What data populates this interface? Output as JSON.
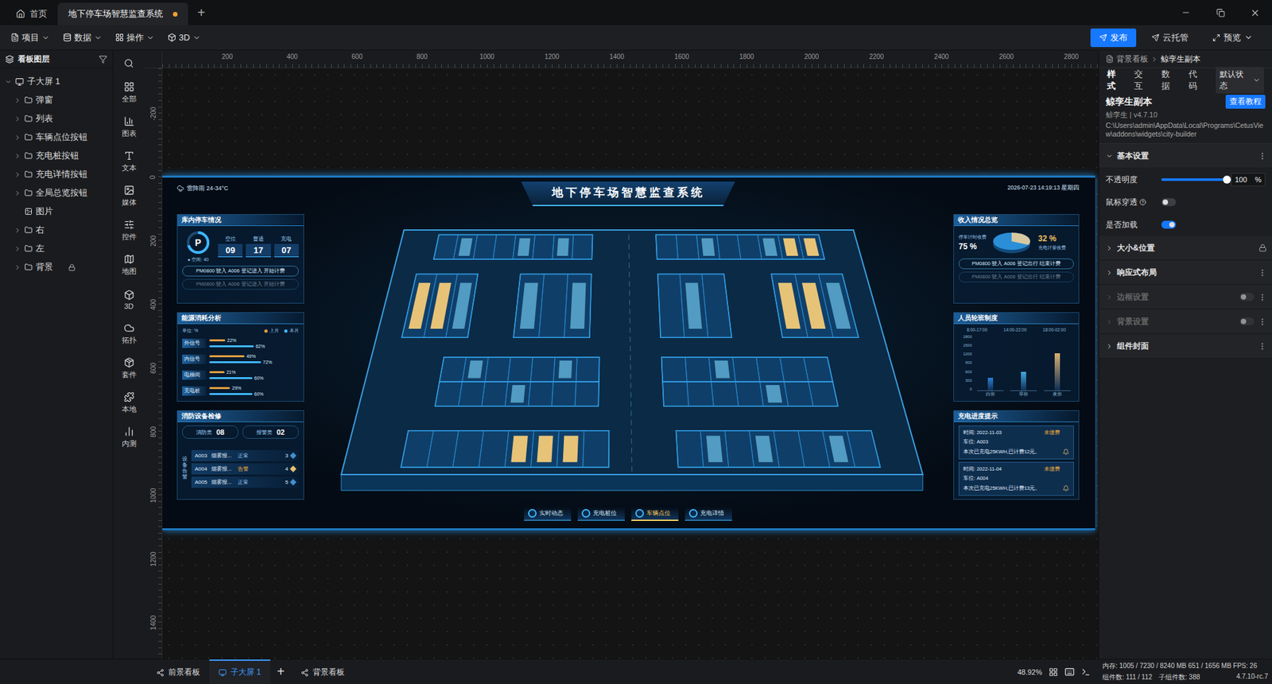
{
  "tabs": [
    {
      "label": "首页",
      "selected": false,
      "modified": false,
      "kind": "home"
    },
    {
      "label": "地下停车场智慧监查系统",
      "selected": true,
      "modified": true,
      "kind": "doc"
    }
  ],
  "new_tab": "+",
  "menus": [
    {
      "label": "项目",
      "kind": "project"
    },
    {
      "label": "数据",
      "kind": "data"
    },
    {
      "label": "操作",
      "kind": "ops"
    },
    {
      "label": "3D",
      "kind": "3d"
    }
  ],
  "actions": [
    {
      "label": "发布",
      "primary": true,
      "kind": "publish"
    },
    {
      "label": "云托管",
      "primary": false,
      "kind": "cloud"
    },
    {
      "label": "预览",
      "primary": false,
      "kind": "preview"
    }
  ],
  "layers": {
    "title": "看板图层",
    "root": {
      "label": "子大屏 1",
      "expanded": true
    },
    "items": [
      {
        "label": "弹窗",
        "expandable": true,
        "locked": false,
        "kind": "group"
      },
      {
        "label": "列表",
        "expandable": true,
        "locked": false,
        "kind": "group"
      },
      {
        "label": "车辆点位按钮",
        "expandable": true,
        "locked": false,
        "kind": "group"
      },
      {
        "label": "充电桩按钮",
        "expandable": true,
        "locked": false,
        "kind": "group"
      },
      {
        "label": "充电详情按钮",
        "expandable": true,
        "locked": false,
        "kind": "group"
      },
      {
        "label": "全局总览按钮",
        "expandable": true,
        "locked": false,
        "kind": "group"
      },
      {
        "label": "图片",
        "expandable": false,
        "locked": false,
        "kind": "image"
      },
      {
        "label": "右",
        "expandable": true,
        "locked": false,
        "kind": "group"
      },
      {
        "label": "左",
        "expandable": true,
        "locked": false,
        "kind": "group"
      },
      {
        "label": "背景",
        "expandable": true,
        "locked": true,
        "kind": "group"
      }
    ]
  },
  "widgets": [
    {
      "label": "全部",
      "kind": "all"
    },
    {
      "label": "图表",
      "kind": "chart"
    },
    {
      "label": "文本",
      "kind": "text"
    },
    {
      "label": "媒体",
      "kind": "media"
    },
    {
      "label": "控件",
      "kind": "control"
    },
    {
      "label": "地图",
      "kind": "map"
    },
    {
      "label": "3D",
      "kind": "3d"
    },
    {
      "label": "拓扑",
      "kind": "topo"
    },
    {
      "label": "套件",
      "kind": "kit"
    },
    {
      "label": "本地",
      "kind": "local"
    },
    {
      "label": "内测",
      "kind": "beta"
    }
  ],
  "rulers": {
    "top": [
      "200",
      "400",
      "600",
      "800",
      "1000",
      "1200",
      "1400",
      "1600",
      "1800",
      "2000",
      "2200",
      "2400",
      "2600",
      "2800"
    ],
    "left": [
      "-200",
      "0",
      "200",
      "400",
      "600",
      "800",
      "1000",
      "1200",
      "1400"
    ]
  },
  "dashboard": {
    "weather": "雷阵雨 24-34°C",
    "title": "地下停车场智慧监查系统",
    "datetime": "2026-07-23 14:19:13 星期四",
    "parking": {
      "title": "库内停车情况",
      "gauge_label": "P",
      "gauge_level": 0.7,
      "free": "● 空闲: 40",
      "stats": [
        {
          "label": "空位",
          "value": "09"
        },
        {
          "label": "普通",
          "value": "17"
        },
        {
          "label": "充电",
          "value": "07"
        }
      ],
      "logs": [
        {
          "text": "PM0800 驶入 A006 登记进入 开始计费",
          "faded": false
        },
        {
          "text": "PM0800 驶入 A006 登记进入 开始计费",
          "faded": true
        }
      ]
    },
    "energy": {
      "title": "能源消耗分析",
      "unit": "单位: %",
      "legend": [
        {
          "label": "上月",
          "color": "#e0a040"
        },
        {
          "label": "本月",
          "color": "#3fb6ff"
        }
      ],
      "rows": [
        {
          "label": "外信号",
          "values": [
            22,
            62
          ],
          "texts": [
            "22%",
            "62%"
          ]
        },
        {
          "label": "内信号",
          "values": [
            49,
            72
          ],
          "texts": [
            "49%",
            "72%"
          ]
        },
        {
          "label": "电梯间",
          "values": [
            21,
            60
          ],
          "texts": [
            "21%",
            "60%"
          ]
        },
        {
          "label": "充电桩",
          "values": [
            29,
            60
          ],
          "texts": [
            "29%",
            "60%"
          ]
        }
      ]
    },
    "fire": {
      "title": "消防设备检修",
      "side_label": "设备告警",
      "counts": [
        {
          "label": "消防类",
          "value": "08"
        },
        {
          "label": "报警类",
          "value": "02"
        }
      ],
      "rows": [
        {
          "id": "A003",
          "name": "烟雾报...",
          "status": "正常",
          "count": "3",
          "alarm": false
        },
        {
          "id": "A004",
          "name": "烟雾报...",
          "status": "告警",
          "count": "4",
          "alarm": true
        },
        {
          "id": "A005",
          "name": "烟雾报...",
          "status": "正常",
          "count": "5",
          "alarm": false
        }
      ]
    },
    "income": {
      "title": "收入情况总览",
      "left_label": "停车计时收费",
      "left_value": "75 %",
      "right_value": "32 %",
      "right_label": "充电计量收费",
      "share": 0.32,
      "logs": [
        {
          "text": "PM0800 驶入 A006 登记出行 结束计费",
          "faded": false
        },
        {
          "text": "PM0800 驶入 A006 登记出行 结束计费",
          "faded": true
        }
      ]
    },
    "shifts": {
      "title": "人员轮班制度",
      "times": [
        "8:00-17:00",
        "14:00-22:00",
        "18:00-02:00"
      ],
      "y_ticks": [
        "1800",
        "1500",
        "1200",
        "900",
        "600",
        "300",
        "0"
      ],
      "y_max": 1800,
      "bars": [
        {
          "label": "白班",
          "value": 400,
          "color": "#2e7fd6"
        },
        {
          "label": "早班",
          "value": 600,
          "color": "#3fa8e0"
        },
        {
          "label": "夜班",
          "value": 1200,
          "color": "#d8b070"
        }
      ]
    },
    "charging": {
      "title": "充电进度提示",
      "cards": [
        {
          "time": "时间: 2022-11-03",
          "status": "未缴费",
          "slot": "车位: A003",
          "detail": "本次已充电25KWH,已计费12元。"
        },
        {
          "time": "时间: 2022-11-04",
          "status": "未缴费",
          "slot": "车位: A004",
          "detail": "本次已充电25KWH,已计费13元。"
        }
      ]
    },
    "nav": [
      {
        "label": "实时动态",
        "selected": false
      },
      {
        "label": "充电桩位",
        "selected": false
      },
      {
        "label": "车辆点位",
        "selected": true
      },
      {
        "label": "充电详情",
        "selected": false
      }
    ]
  },
  "inspector": {
    "breadcrumb": [
      "背景看板",
      "鲸孪生副本"
    ],
    "tabs": [
      {
        "label": "样式",
        "selected": true
      },
      {
        "label": "交互",
        "selected": false
      },
      {
        "label": "数据",
        "selected": false
      },
      {
        "label": "代码",
        "selected": false
      }
    ],
    "state_select": "默认状态",
    "widget": {
      "name": "鲸孪生副本",
      "version": "鲸孪生 | v4.7.10",
      "path": "C:\\Users\\admin\\AppData\\Local\\Programs\\CetusView\\addons\\widgets\\city-builder",
      "tutorial": "查看教程"
    },
    "basic": {
      "label": "基本设置",
      "expanded": true,
      "opacity": {
        "label": "不透明度",
        "level": 1,
        "value": "100",
        "unit": "%"
      },
      "toggles": [
        {
          "label": "鼠标穿透",
          "help": true,
          "on": false
        },
        {
          "label": "是否加载",
          "help": false,
          "on": true
        }
      ]
    },
    "sections": [
      {
        "label": "大小&位置",
        "kind": "lock",
        "disabled": false,
        "on": false
      },
      {
        "label": "响应式布局",
        "kind": "menu",
        "disabled": false,
        "on": false
      },
      {
        "label": "边框设置",
        "kind": "toggle",
        "disabled": true,
        "on": false
      },
      {
        "label": "背景设置",
        "kind": "toggle",
        "disabled": true,
        "on": false
      },
      {
        "label": "组件封面",
        "kind": "menu",
        "disabled": false,
        "on": false
      }
    ]
  },
  "bottom_bar": {
    "boards": [
      {
        "label": "前景看板",
        "selected": false,
        "kind": "board"
      },
      {
        "label": "子大屏 1",
        "selected": true,
        "kind": "screen"
      },
      {
        "label": "+",
        "selected": false,
        "kind": "add"
      },
      {
        "label": "背景看板",
        "selected": false,
        "kind": "board"
      }
    ],
    "zoom": "48.92%"
  },
  "status": {
    "memory": "内存: 1005 / 7230 / 8240 MB  651 / 1656 MB FPS: 26",
    "counts": "组件数: 111 / 112",
    "children": "子组件数: 388",
    "version": "4.7.10-rc.7"
  }
}
